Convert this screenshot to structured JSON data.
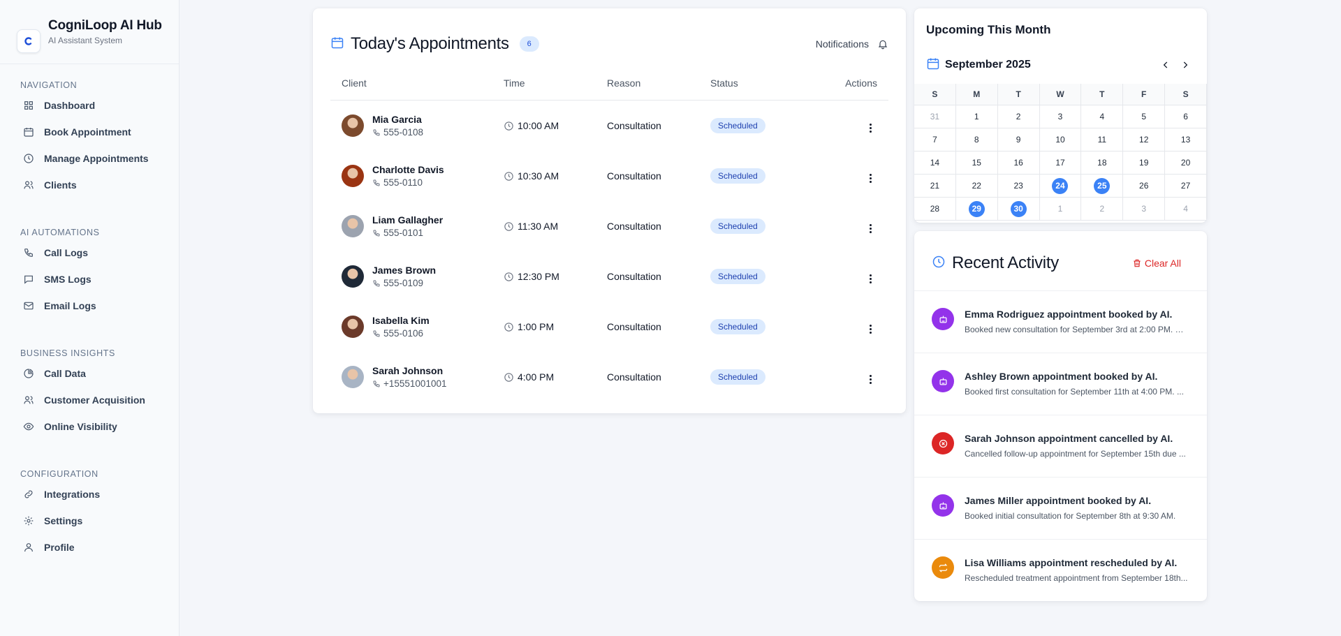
{
  "brand": {
    "title": "CogniLoop AI Hub",
    "subtitle": "AI Assistant System"
  },
  "sidebar": {
    "sections": [
      {
        "heading": "NAVIGATION",
        "items": [
          {
            "label": "Dashboard",
            "icon": "grid-icon"
          },
          {
            "label": "Book Appointment",
            "icon": "calendar-icon"
          },
          {
            "label": "Manage Appointments",
            "icon": "clock-icon"
          },
          {
            "label": "Clients",
            "icon": "users-icon"
          }
        ]
      },
      {
        "heading": "AI AUTOMATIONS",
        "items": [
          {
            "label": "Call Logs",
            "icon": "phone-icon"
          },
          {
            "label": "SMS Logs",
            "icon": "message-icon"
          },
          {
            "label": "Email Logs",
            "icon": "mail-icon"
          }
        ]
      },
      {
        "heading": "BUSINESS INSIGHTS",
        "items": [
          {
            "label": "Call Data",
            "icon": "pie-chart-icon"
          },
          {
            "label": "Customer Acquisition",
            "icon": "users-icon"
          },
          {
            "label": "Online Visibility",
            "icon": "eye-icon"
          }
        ]
      },
      {
        "heading": "CONFIGURATION",
        "items": [
          {
            "label": "Integrations",
            "icon": "link-icon"
          },
          {
            "label": "Settings",
            "icon": "gear-icon"
          },
          {
            "label": "Profile",
            "icon": "user-icon"
          }
        ]
      }
    ]
  },
  "appointments": {
    "title": "Today's Appointments",
    "count": "6",
    "notifications_label": "Notifications",
    "columns": {
      "client": "Client",
      "time": "Time",
      "reason": "Reason",
      "status": "Status",
      "actions": "Actions"
    },
    "rows": [
      {
        "name": "Mia Garcia",
        "phone": "555-0108",
        "time": "10:00 AM",
        "reason": "Consultation",
        "status": "Scheduled",
        "avatar_color": "#7c4a2d"
      },
      {
        "name": "Charlotte Davis",
        "phone": "555-0110",
        "time": "10:30 AM",
        "reason": "Consultation",
        "status": "Scheduled",
        "avatar_color": "#9a3412"
      },
      {
        "name": "Liam Gallagher",
        "phone": "555-0101",
        "time": "11:30 AM",
        "reason": "Consultation",
        "status": "Scheduled",
        "avatar_color": "#9ca3af"
      },
      {
        "name": "James Brown",
        "phone": "555-0109",
        "time": "12:30 PM",
        "reason": "Consultation",
        "status": "Scheduled",
        "avatar_color": "#1f2937"
      },
      {
        "name": "Isabella Kim",
        "phone": "555-0106",
        "time": "1:00 PM",
        "reason": "Consultation",
        "status": "Scheduled",
        "avatar_color": "#6b3a2a"
      },
      {
        "name": "Sarah Johnson",
        "phone": "+15551001001",
        "time": "4:00 PM",
        "reason": "Consultation",
        "status": "Scheduled",
        "avatar_color": "#a8b4c4"
      }
    ]
  },
  "calendar": {
    "heading": "Upcoming This Month",
    "month": "September 2025",
    "weekdays": [
      "S",
      "M",
      "T",
      "W",
      "T",
      "F",
      "S"
    ],
    "weeks": [
      [
        {
          "d": "31",
          "m": true
        },
        {
          "d": "1"
        },
        {
          "d": "2"
        },
        {
          "d": "3"
        },
        {
          "d": "4"
        },
        {
          "d": "5"
        },
        {
          "d": "6"
        }
      ],
      [
        {
          "d": "7"
        },
        {
          "d": "8"
        },
        {
          "d": "9"
        },
        {
          "d": "10"
        },
        {
          "d": "11"
        },
        {
          "d": "12"
        },
        {
          "d": "13"
        }
      ],
      [
        {
          "d": "14"
        },
        {
          "d": "15"
        },
        {
          "d": "16"
        },
        {
          "d": "17"
        },
        {
          "d": "18"
        },
        {
          "d": "19"
        },
        {
          "d": "20"
        }
      ],
      [
        {
          "d": "21"
        },
        {
          "d": "22"
        },
        {
          "d": "23"
        },
        {
          "d": "24",
          "h": true
        },
        {
          "d": "25",
          "h": true
        },
        {
          "d": "26"
        },
        {
          "d": "27"
        }
      ],
      [
        {
          "d": "28"
        },
        {
          "d": "29",
          "h": true
        },
        {
          "d": "30",
          "h": true
        },
        {
          "d": "1",
          "m": true
        },
        {
          "d": "2",
          "m": true
        },
        {
          "d": "3",
          "m": true
        },
        {
          "d": "4",
          "m": true
        }
      ]
    ],
    "highlight_color": "#3b82f6"
  },
  "activity": {
    "title": "Recent Activity",
    "clear_label": "Clear All",
    "items": [
      {
        "title": "Emma Rodriguez appointment booked by AI.",
        "desc": "Booked new consultation for September 3rd at 2:00 PM. Fi...",
        "color": "#9333ea",
        "icon": "robot-icon"
      },
      {
        "title": "Ashley Brown appointment booked by AI.",
        "desc": "Booked first consultation for September 11th at 4:00 PM. ...",
        "color": "#9333ea",
        "icon": "robot-icon"
      },
      {
        "title": "Sarah Johnson appointment cancelled by AI.",
        "desc": "Cancelled follow-up appointment for September 15th due ...",
        "color": "#dc2626",
        "icon": "x-circle-icon"
      },
      {
        "title": "James Miller appointment booked by AI.",
        "desc": "Booked initial consultation for September 8th at 9:30 AM.",
        "color": "#9333ea",
        "icon": "robot-icon"
      },
      {
        "title": "Lisa Williams appointment rescheduled by AI.",
        "desc": "Rescheduled treatment appointment from September 18th...",
        "color": "#ea8a0c",
        "icon": "repeat-icon"
      }
    ]
  }
}
